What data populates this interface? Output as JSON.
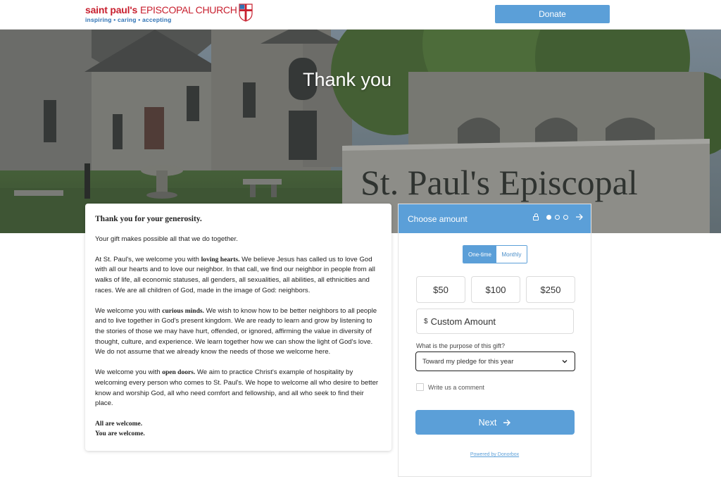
{
  "header": {
    "logo_name": "saint paul's",
    "logo_church": "EPISCOPAL CHURCH",
    "logo_tagline": "inspiring • caring • accepting",
    "donate_label": "Donate"
  },
  "hero": {
    "title": "Thank you",
    "sign_text": "St. Paul's Episcopal"
  },
  "message": {
    "heading": "Thank you for your generosity.",
    "intro": "Your gift makes possible all that we do together.",
    "p1_start": "At St. Paul's, we welcome you with ",
    "p1_bold": "loving hearts.",
    "p1_rest": " We believe Jesus has called us to love God with all our hearts and to love our neighbor. In that call, we find our neighbor in people from all walks of life, all economic statuses, all genders, all sexualities, all abilities, all ethnicities and races. We are all children of God, made in the image of God: neighbors.",
    "p2_start": "We welcome you with ",
    "p2_bold": "curious minds.",
    "p2_rest": " We wish to know how to be better neighbors to all people and to live together in God's present kingdom. We are ready to learn and grow by listening to the stories of those we may have hurt, offended, or ignored, affirming the value in diversity of thought, culture, and experience. We learn together how we can show the light of God's love. We do not assume that we already know the needs of those we welcome here.",
    "p3_start": "We welcome you with ",
    "p3_bold": "open doors.",
    "p3_rest": " We aim to practice Christ's example of hospitality by welcoming every person who comes to St. Paul's. We hope to welcome all who desire to better know and worship God, all who need comfort and fellowship, and all who seek to find their place.",
    "closing1": "All are welcome.",
    "closing2": "You are welcome."
  },
  "donation": {
    "title": "Choose amount",
    "step_current": 1,
    "step_total": 3,
    "frequency_options": [
      "One-time",
      "Monthly"
    ],
    "frequency_selected": "One-time",
    "amounts": [
      "$50",
      "$100",
      "$250"
    ],
    "currency_symbol": "$",
    "custom_amount_label": "Custom Amount",
    "purpose_label": "What is the purpose of this gift?",
    "purpose_selected": "Toward my pledge for this year",
    "comment_label": "Write us a comment",
    "comment_checked": false,
    "next_label": "Next",
    "powered_by": "Powered by Donorbox"
  },
  "colors": {
    "accent": "#5b9fd8",
    "brand_red": "#c8202f",
    "brand_blue": "#2f73b5"
  },
  "icons": [
    "cross-shield-icon",
    "lock-icon",
    "arrow-right-icon",
    "chevron-down-icon"
  ]
}
